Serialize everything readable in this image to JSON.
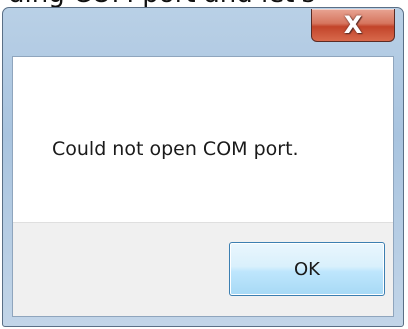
{
  "background": {
    "partial_text": "ding COM port and let's"
  },
  "dialog": {
    "title": "",
    "message": "Could not open COM port.",
    "close_glyph": "X",
    "ok_label": "OK"
  },
  "colors": {
    "frame": "#a9c4df",
    "close_button": "#c2442a",
    "button_area": "#f0f0f0",
    "ok_border": "#3c7fb1"
  },
  "icons": {
    "close": "close-icon"
  }
}
